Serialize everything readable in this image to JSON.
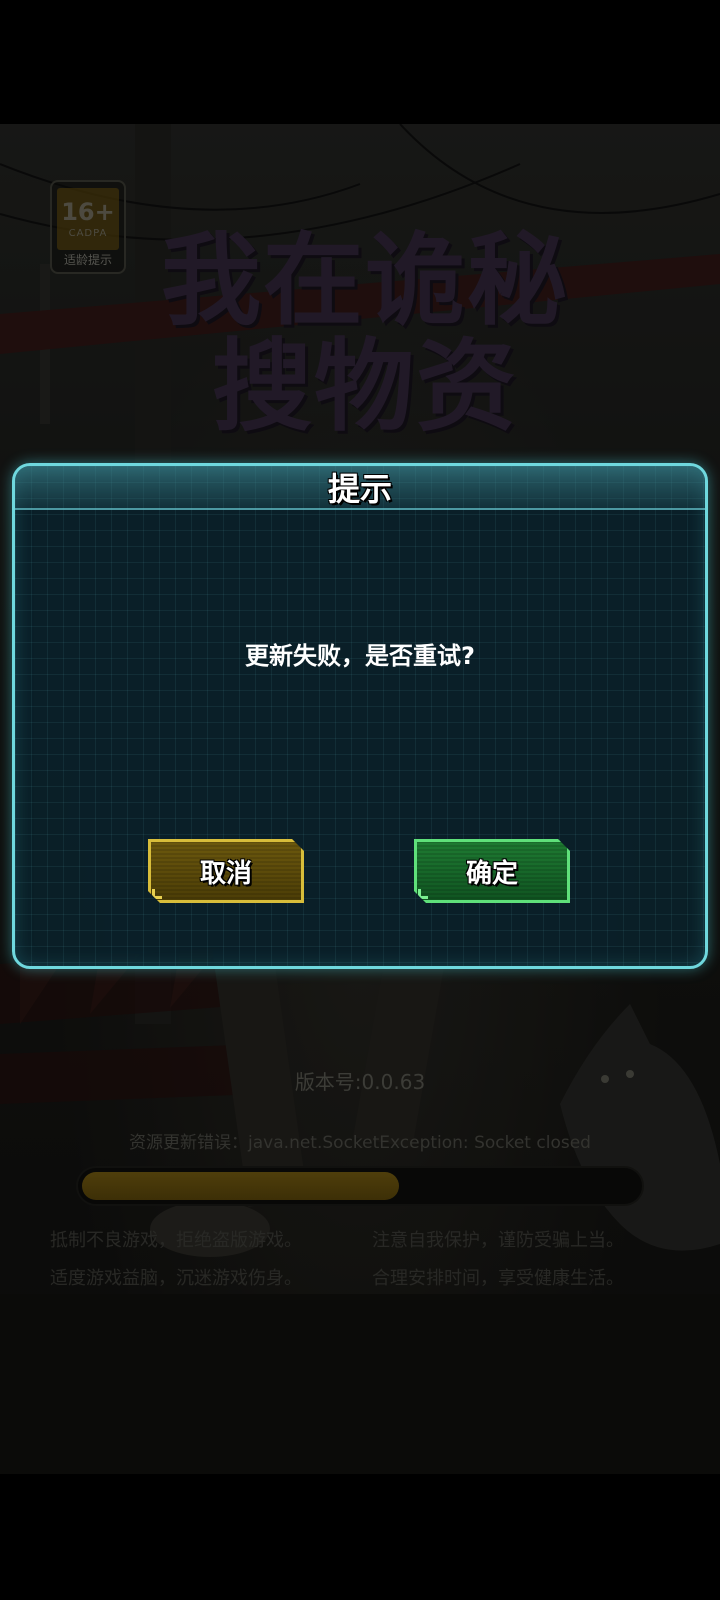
{
  "background": {
    "age_badge": {
      "number": "16+",
      "org": "CADPA",
      "caption": "适龄提示"
    },
    "logo": {
      "line1": "我在诡秘",
      "line2": "搜物资"
    },
    "version": "版本号:0.0.63",
    "error_message": "资源更新错误：java.net.SocketException: Socket closed",
    "progress": {
      "value": 0.57
    },
    "health_notice": [
      "抵制不良游戏，拒绝盗版游戏。",
      "注意自我保护，谨防受骗上当。",
      "适度游戏益脑，沉迷游戏伤身。",
      "合理安排时间，享受健康生活。"
    ]
  },
  "dialog": {
    "title": "提示",
    "message": "更新失败，是否重试?",
    "cancel_label": "取消",
    "confirm_label": "确定"
  },
  "colors": {
    "dialog_border": "#6fd8de",
    "cancel_button": "#d8bd3a",
    "confirm_button": "#5fe07a",
    "progress_fill": "#9e7d16"
  }
}
